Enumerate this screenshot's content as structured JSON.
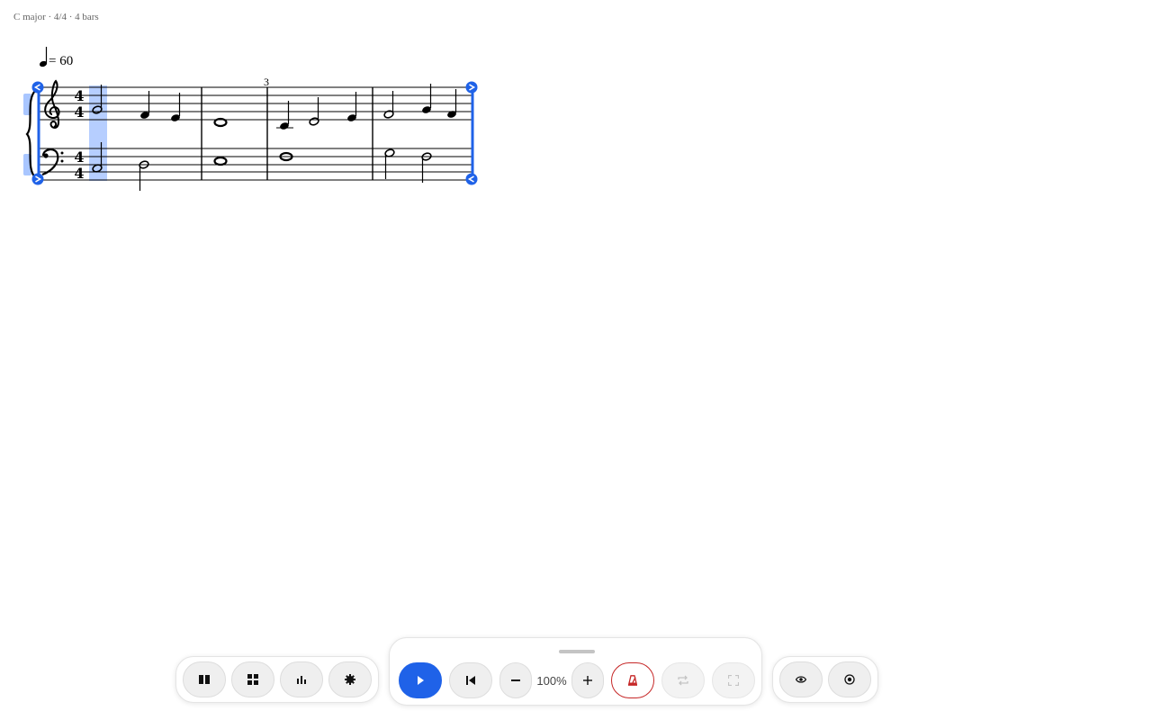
{
  "header": {
    "info": "C major · 4/4 · 4 bars"
  },
  "score": {
    "tempo_text": "= 60",
    "measure_number": "3",
    "time_signature": {
      "upper": "4",
      "lower": "4"
    }
  },
  "playback": {
    "zoom_label": "100%"
  },
  "colors": {
    "accent": "#1f62e8",
    "selection": "#a9c6ff",
    "metronome": "#c62828"
  },
  "icons": {
    "left_toolbar": [
      "single-page-view-icon",
      "grid-view-icon",
      "bar-chart-icon",
      "gear-icon"
    ],
    "center_toolbar": [
      "play-icon",
      "skip-to-start-icon",
      "zoom-out-icon",
      "zoom-in-icon",
      "metronome-icon",
      "loop-icon",
      "fullscreen-icon"
    ],
    "right_toolbar": [
      "eye-icon",
      "record-target-icon"
    ]
  }
}
